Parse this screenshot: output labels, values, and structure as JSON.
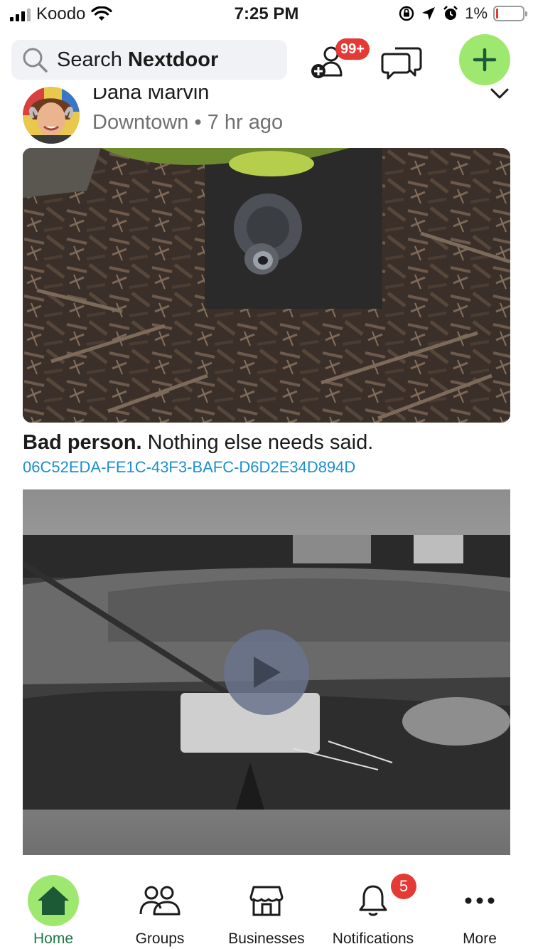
{
  "status_bar": {
    "carrier": "Koodo",
    "time": "7:25 PM",
    "battery_percent": "1%",
    "battery_level": 0.01
  },
  "header": {
    "search_prefix": "Search",
    "search_brand": "Nextdoor",
    "friends_badge": "99+",
    "colors": {
      "accent_green": "#9fe870",
      "badge_red": "#e53935"
    }
  },
  "post": {
    "author_name": "Dana Marvin",
    "location": "Downtown",
    "separator": "•",
    "time_ago": "7 hr ago",
    "text_bold": "Bad person.",
    "text_rest": " Nothing else needs said.",
    "link": "06C52EDA-FE1C-43F3-BAFC-D6D2E34D894D"
  },
  "bottom_nav": {
    "items": [
      {
        "label": "Home",
        "icon": "house-icon",
        "active": true
      },
      {
        "label": "Groups",
        "icon": "people-icon",
        "active": false
      },
      {
        "label": "Businesses",
        "icon": "storefront-icon",
        "active": false
      },
      {
        "label": "Notifications",
        "icon": "bell-icon",
        "active": false
      },
      {
        "label": "More",
        "icon": "more-dots-icon",
        "active": false
      }
    ],
    "notifications_badge": "5"
  }
}
